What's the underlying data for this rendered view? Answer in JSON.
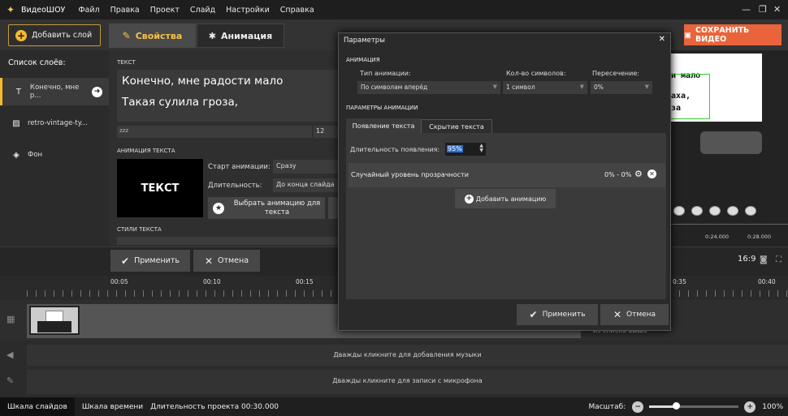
{
  "app": {
    "name": "ВидеоШОУ"
  },
  "menu": [
    "Файл",
    "Правка",
    "Проект",
    "Слайд",
    "Настройки",
    "Справка"
  ],
  "toolbar": {
    "add_layer": "Добавить слой",
    "tab_properties": "Свойства",
    "tab_animation": "Анимация",
    "save_video": "СОХРАНИТЬ ВИДЕО"
  },
  "layers": {
    "title": "Список слоёв:",
    "items": [
      {
        "icon": "text-icon",
        "label": "Конечно, мне р..."
      },
      {
        "icon": "image-icon",
        "label": "retro-vintage-ty..."
      },
      {
        "icon": "fill-icon",
        "label": "Фон"
      }
    ]
  },
  "properties": {
    "text_label": "ТЕКСТ",
    "text_line1": "Конечно, мне радости мало",
    "text_line2": "Такая сулила гроза,",
    "font_value": "zzz",
    "font_size": "12",
    "anim_text_label": "АНИМАЦИЯ ТЕКСТА",
    "preview_text": "ТЕКСТ",
    "start_label": "Старт анимации:",
    "start_value": "Сразу",
    "duration_label": "Длительность:",
    "duration_value": "До конца слайда",
    "choose_anim": "Выбрать анимацию для текста",
    "styles_label": "СТИЛИ ТЕКСТА"
  },
  "preview": {
    "line1": "и мало",
    "line2": "аха,",
    "line3": "за",
    "ruler": [
      "0:24.000",
      "0:28.000"
    ],
    "ratio": "16:9"
  },
  "apply": {
    "apply": "Применить",
    "cancel": "Отмена"
  },
  "timeline": {
    "ticks": [
      "00:05",
      "00:10",
      "00:15",
      "0:35",
      "00:40"
    ],
    "music_hint": "Дважды кликните для добавления музыки",
    "mic_hint": "Дважды кликните для записи с микрофона",
    "list_hint": "из списка выше"
  },
  "status": {
    "tab_slides": "Шкала слайдов",
    "tab_timeline": "Шкала времени",
    "duration": "Длительность проекта 00:30.000",
    "scale_label": "Масштаб:",
    "zoom": "100%",
    "zoom_fraction": 0.3
  },
  "dialog": {
    "title": "Параметры",
    "section_anim": "АНИМАЦИЯ",
    "type_label": "Тип анимации:",
    "type_value": "По символам вперёд",
    "count_label": "Кол-во символов:",
    "count_value": "1 символ",
    "overlap_label": "Пересечение:",
    "overlap_value": "0%",
    "section_params": "ПАРАМЕТРЫ АНИМАЦИИ",
    "tab_appear": "Появление текста",
    "tab_hide": "Скрытие текста",
    "appear_duration_label": "Длительность появления:",
    "appear_duration_value": "95%",
    "effect_name": "Случайный уровень прозрачности",
    "effect_range": "0% - 0%",
    "add_animation": "Добавить анимацию",
    "apply": "Применить",
    "cancel": "Отмена"
  },
  "colors": {
    "accent": "#f5b92e",
    "save": "#e9643a",
    "selection": "#2a6fd6"
  }
}
